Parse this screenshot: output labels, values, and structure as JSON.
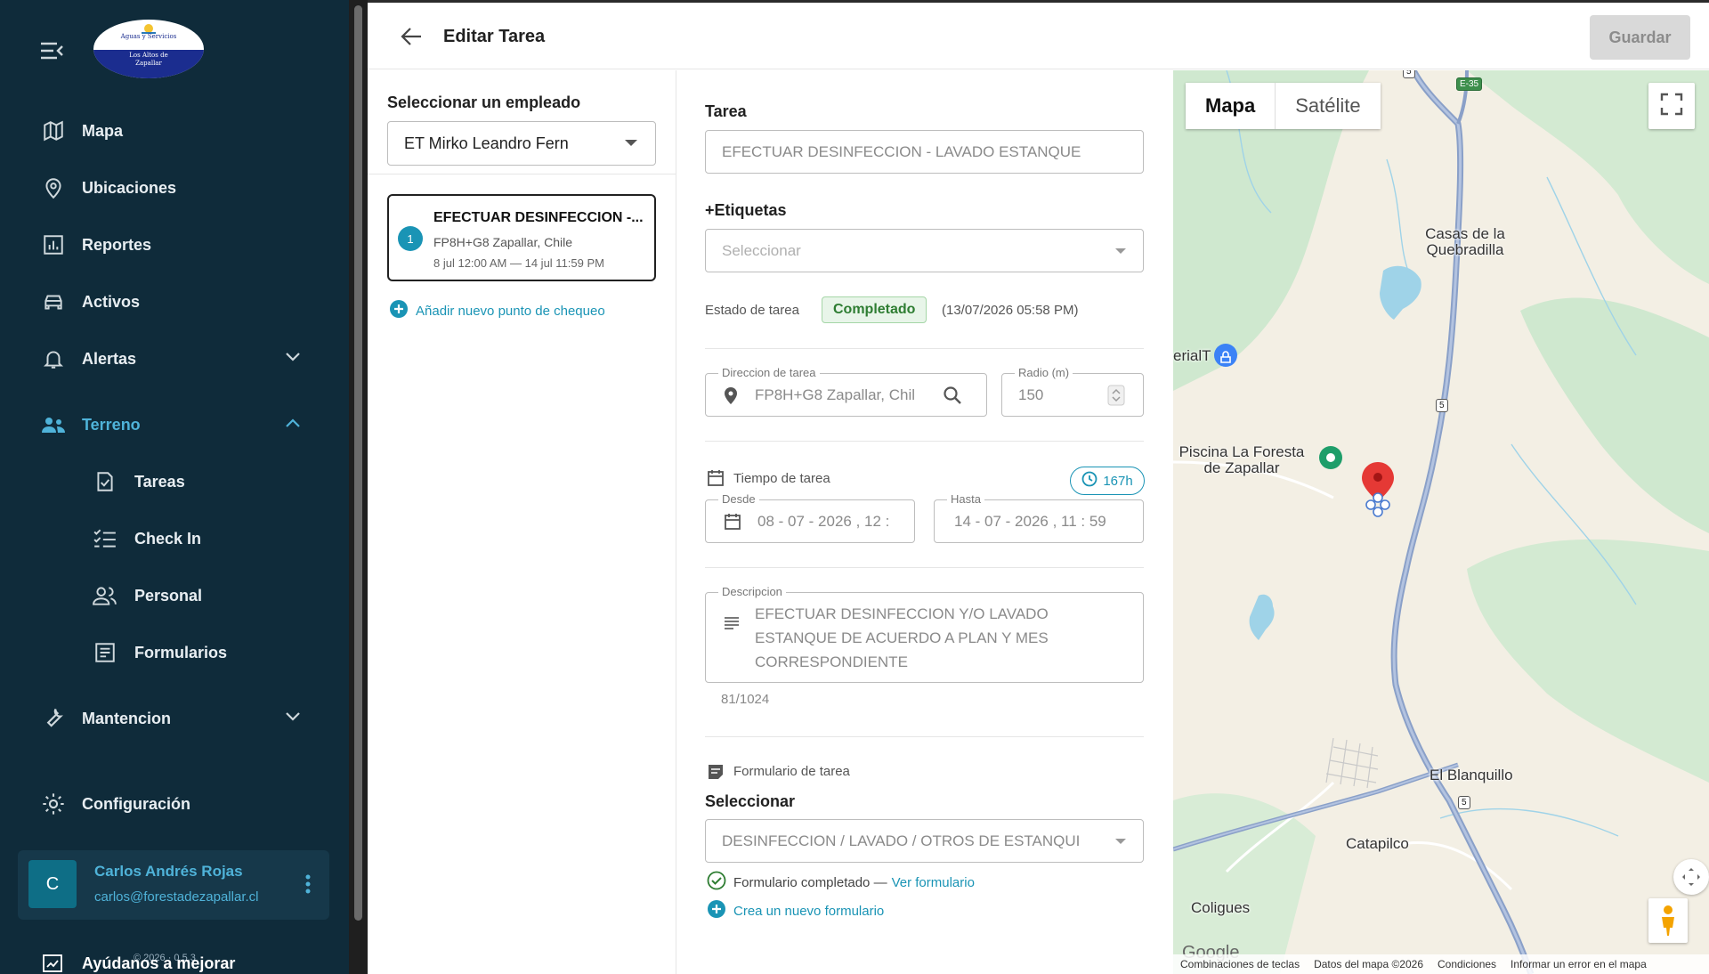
{
  "brand": {
    "logo_line1": "Aguas y Servicios",
    "logo_line2": "Los Altos de",
    "logo_line3": "Zapallar"
  },
  "sidebar": {
    "items": [
      {
        "label": "Mapa",
        "icon": "map-icon"
      },
      {
        "label": "Ubicaciones",
        "icon": "location-pin-icon"
      },
      {
        "label": "Reportes",
        "icon": "bar-chart-icon"
      },
      {
        "label": "Activos",
        "icon": "car-icon"
      },
      {
        "label": "Alertas",
        "icon": "bell-icon"
      },
      {
        "label": "Terreno",
        "icon": "field-workers-icon"
      },
      {
        "label": "Tareas",
        "icon": "task-check-icon"
      },
      {
        "label": "Check In",
        "icon": "checklist-icon"
      },
      {
        "label": "Personal",
        "icon": "people-icon"
      },
      {
        "label": "Formularios",
        "icon": "form-icon"
      },
      {
        "label": "Mantencion",
        "icon": "wrench-icon"
      },
      {
        "label": "Configuración",
        "icon": "gear-icon"
      }
    ],
    "user": {
      "initial": "C",
      "name": "Carlos Andrés Rojas",
      "email": "carlos@forestadezapallar.cl"
    },
    "help_label": "Ayúdanos a mejorar",
    "version": "© 2026 · 0.5.3"
  },
  "topbar": {
    "title": "Editar Tarea",
    "save_label": "Guardar"
  },
  "employee": {
    "header": "Seleccionar un empleado",
    "selected": "ET Mirko Leandro Fern",
    "task": {
      "number": "1",
      "title": "EFECTUAR DESINFECCION -...",
      "address": "FP8H+G8 Zapallar, Chile",
      "dates": "8 jul 12:00 AM — 14 jul 11:59 PM"
    },
    "add_checkpoint": "Añadir nuevo punto de chequeo"
  },
  "form": {
    "task_label": "Tarea",
    "task_value": "EFECTUAR DESINFECCION - LAVADO ESTANQUE",
    "tags_label": "+Etiquetas",
    "tags_placeholder": "Seleccionar",
    "status_label": "Estado de tarea",
    "status_value": "Completado",
    "status_date": "(13/07/2026 05:58 PM)",
    "address_legend": "Direccion de tarea",
    "address_value": "FP8H+G8 Zapallar, Chil",
    "radius_legend": "Radio (m)",
    "radius_value": "150",
    "time_label": "Tiempo de tarea",
    "duration": "167h",
    "from_legend": "Desde",
    "from_value": "08 - 07 - 2026 ,  12 :",
    "to_legend": "Hasta",
    "to_value": "14 - 07 - 2026 ,  11 : 59",
    "desc_legend": "Descripcion",
    "desc_line1": "EFECTUAR DESINFECCION Y/O LAVADO",
    "desc_line2": "ESTANQUE DE ACUERDO A PLAN Y MES",
    "desc_line3": "CORRESPONDIENTE",
    "desc_count": "81/1024",
    "form_label": "Formulario de tarea",
    "select_label": "Seleccionar",
    "form_value": "DESINFECCION / LAVADO / OTROS DE ESTANQUI",
    "form_done": "Formulario completado —",
    "view_form": "Ver formulario",
    "new_form": "Crea un nuevo formulario"
  },
  "map": {
    "tab_map": "Mapa",
    "tab_satellite": "Satélite",
    "places": {
      "casas": "Casas de la Quebradilla",
      "ferial": "erialT",
      "piscina": "Piscina La Foresta de Zapallar",
      "blanquillo": "El Blanquillo",
      "catapilco": "Catapilco",
      "coligues": "Coligues"
    },
    "road_e35": "E-35",
    "road_5": "5",
    "google": "Google",
    "footer": {
      "shortcuts": "Combinaciones de teclas",
      "data": "Datos del mapa ©2026",
      "terms": "Condiciones",
      "report": "Informar un error en el mapa"
    }
  },
  "colors": {
    "sidebar_bg": "#0f2b3a",
    "accent": "#1a94b5",
    "success": "#2e7d32",
    "marker": "#e53935"
  }
}
